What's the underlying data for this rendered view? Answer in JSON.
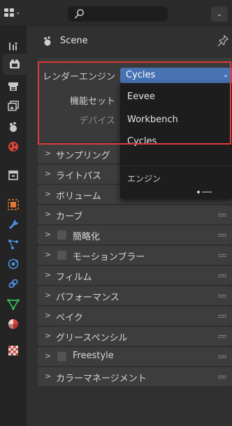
{
  "header": {
    "search_placeholder": "",
    "filter_caret": "⌄"
  },
  "context": {
    "scene_name": "Scene"
  },
  "render": {
    "engine_label": "レンダーエンジン",
    "engine_value": "Cycles",
    "feature_set_label": "機能セット",
    "device_label": "デバイス"
  },
  "dropdown": {
    "items": [
      "Eevee",
      "Workbench",
      "Cycles"
    ],
    "footer": "エンジン"
  },
  "sections": [
    {
      "label": "サンプリング",
      "checkbox": false
    },
    {
      "label": "ライトパス",
      "checkbox": false
    },
    {
      "label": "ボリューム",
      "checkbox": false
    },
    {
      "label": "カーブ",
      "checkbox": false
    },
    {
      "label": "簡略化",
      "checkbox": true
    },
    {
      "label": "モーションブラー",
      "checkbox": true
    },
    {
      "label": "フィルム",
      "checkbox": false
    },
    {
      "label": "パフォーマンス",
      "checkbox": false
    },
    {
      "label": "ベイク",
      "checkbox": false
    },
    {
      "label": "グリースペンシル",
      "checkbox": false
    },
    {
      "label": "Freestyle",
      "checkbox": true
    },
    {
      "label": "カラーマネージメント",
      "checkbox": false
    }
  ],
  "colors": {
    "accent": "#4772b3",
    "highlight_box": "#e03a3a",
    "tab_tool": "#8a8a8a",
    "tab_render": "#c9c9c9",
    "tab_output": "#c9c9c9",
    "tab_view_layer": "#c9c9c9",
    "tab_scene": "#c9c9c9",
    "tab_world": "#d8443a",
    "tab_collection": "#c9c9c9",
    "tab_object": "#e07a30",
    "tab_modifiers": "#4d8fe0",
    "tab_particles": "#4d8fe0",
    "tab_physics": "#4d8fe0",
    "tab_constraints": "#4d8fe0",
    "tab_data": "#35c05a",
    "tab_material": "#d8443a",
    "tab_texture": "#c8443a"
  }
}
